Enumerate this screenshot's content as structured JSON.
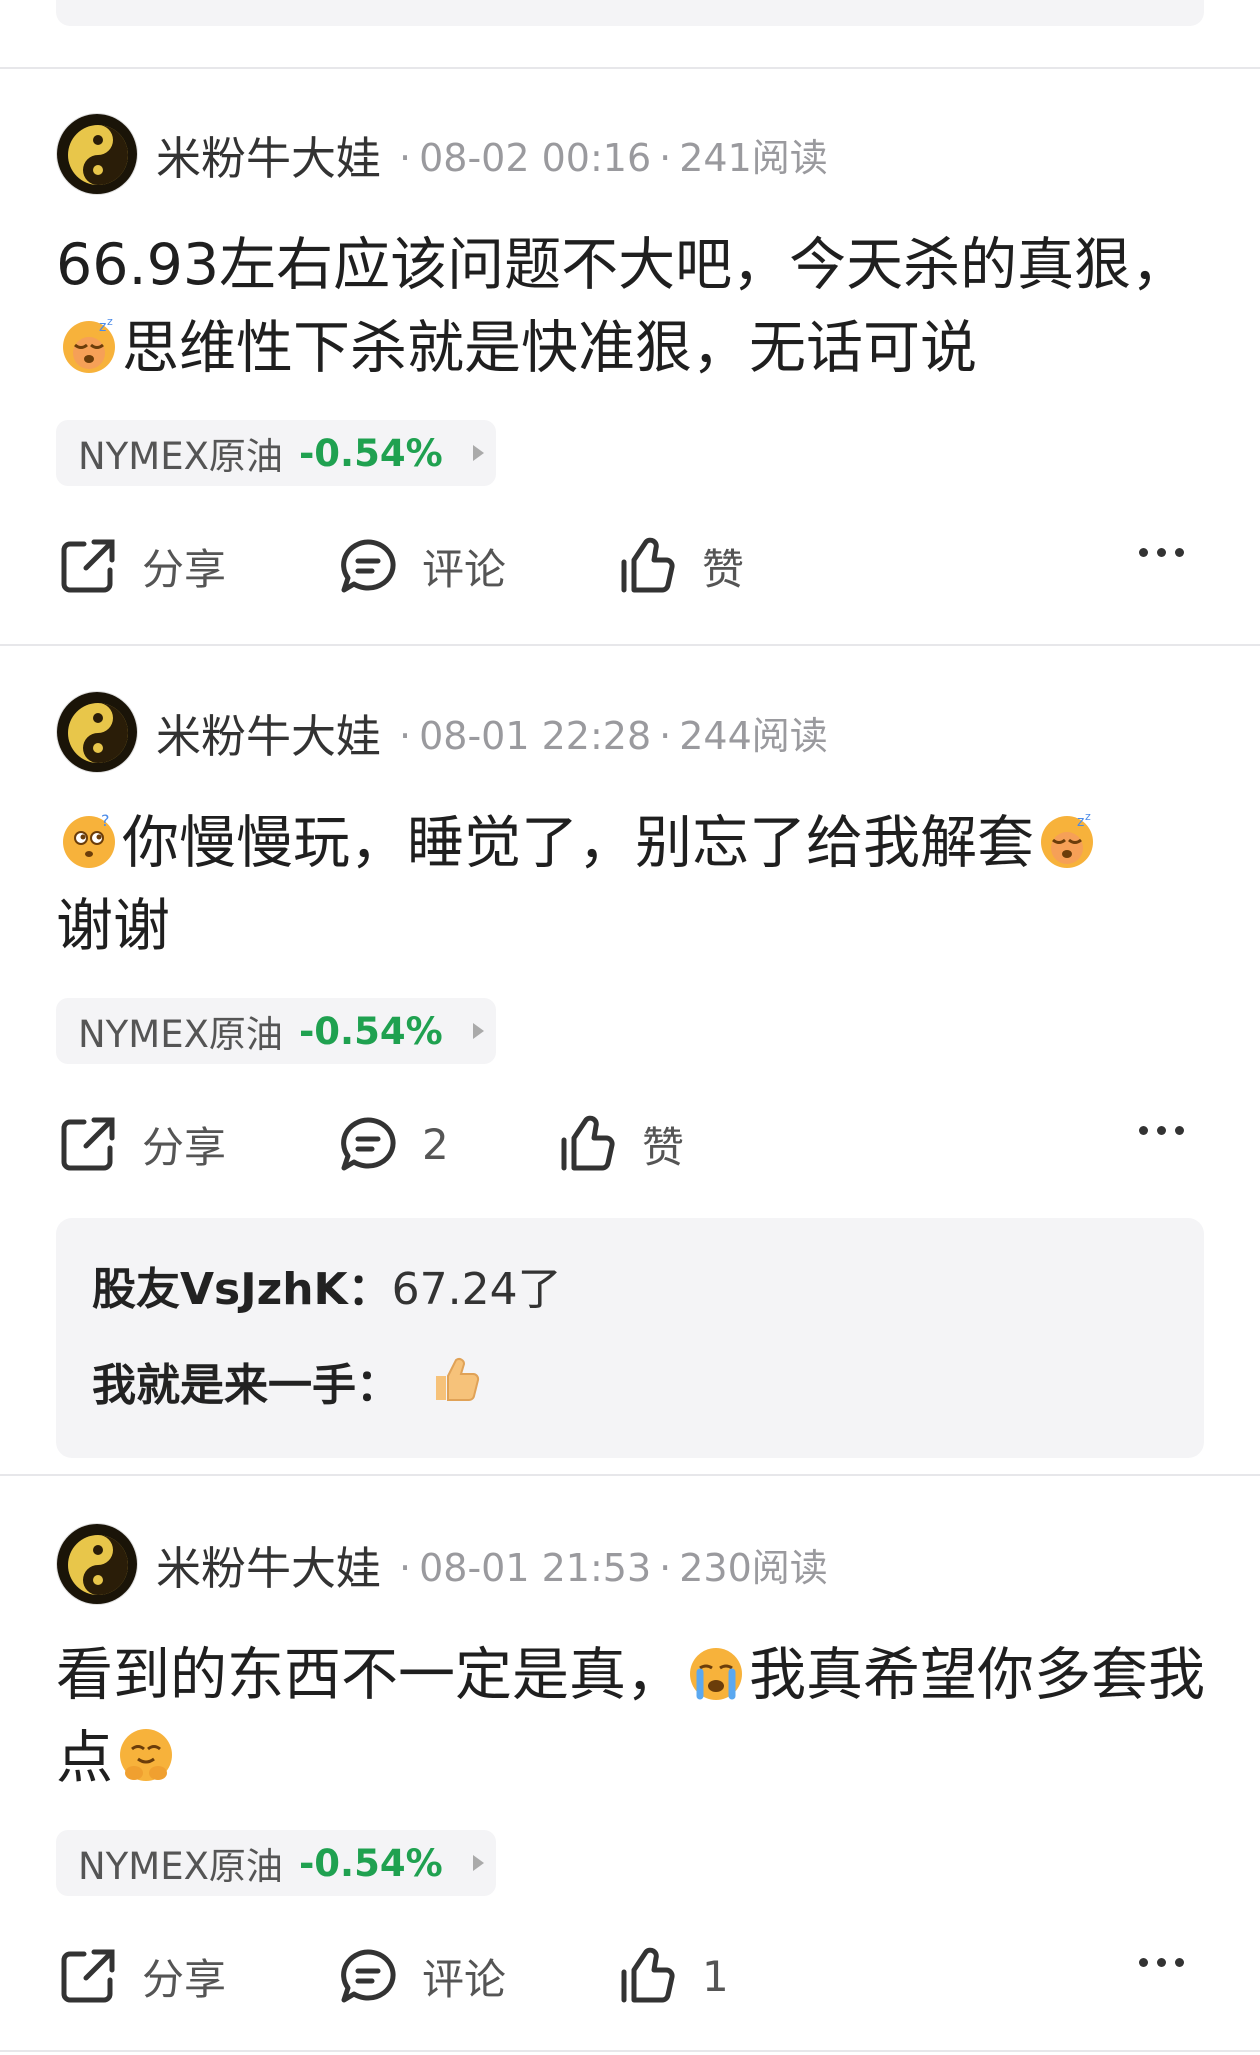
{
  "posts": [
    {
      "author": "米粉牛大娃",
      "date": "08-02 00:16",
      "reads": "241阅读",
      "text_parts": [
        "66.93左右应该问题不大吧，今天杀的真狠，",
        "思维性下杀就是快准狠，无话可说"
      ],
      "emojis": [
        "sleeping-face-emoji"
      ],
      "stock": {
        "name": "NYMEX原油",
        "change": "-0.54%"
      },
      "actions": {
        "share": "分享",
        "comment": "评论",
        "like": "赞"
      }
    },
    {
      "author": "米粉牛大娃",
      "date": "08-01 22:28",
      "reads": "244阅读",
      "text_parts": [
        "你慢慢玩，睡觉了，别忘了给我解套",
        "谢谢"
      ],
      "emojis": [
        "thinking-face-emoji",
        "sleeping-face-emoji"
      ],
      "stock": {
        "name": "NYMEX原油",
        "change": "-0.54%"
      },
      "actions": {
        "share": "分享",
        "comment": "2",
        "like": "赞"
      },
      "replies": [
        {
          "who": "股友VsJzhK：",
          "text": "67.24了"
        },
        {
          "who": "我就是来一手：",
          "text": "",
          "emoji": "thumbs-up-emoji"
        }
      ]
    },
    {
      "author": "米粉牛大娃",
      "date": "08-01 21:53",
      "reads": "230阅读",
      "text_parts": [
        "看到的东西不一定是真，",
        "我真希望你多套我点"
      ],
      "emojis": [
        "crying-face-emoji",
        "hugging-face-emoji"
      ],
      "stock": {
        "name": "NYMEX原油",
        "change": "-0.54%"
      },
      "actions": {
        "share": "分享",
        "comment": "评论",
        "like": "1"
      }
    }
  ],
  "meta_separator": "·",
  "colors": {
    "down": "#1fa150",
    "meta": "#9a9a9e",
    "panel": "#f4f4f6"
  }
}
